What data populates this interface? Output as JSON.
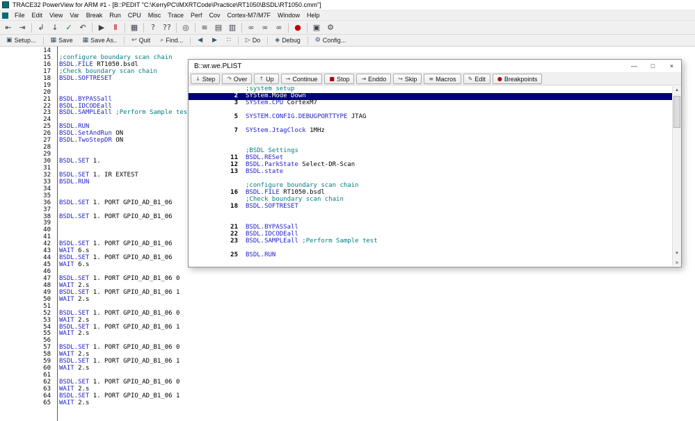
{
  "window": {
    "title": "TRACE32 PowerView for ARM #1 - [B::PEDIT \"C:\\KerryPC\\IMXRTCode\\Practice\\RT1050\\BSDL\\RT1050.cmm\"]"
  },
  "menu": {
    "items": [
      "File",
      "Edit",
      "View",
      "Var",
      "Break",
      "Run",
      "CPU",
      "Misc",
      "Trace",
      "Perf",
      "Cov",
      "Cortex-M7/M7F",
      "Window",
      "Help"
    ]
  },
  "toolbar": {
    "groups": [
      [
        {
          "name": "nav-back-icon",
          "glyph": "⇤"
        },
        {
          "name": "nav-forward-icon",
          "glyph": "⇥"
        }
      ],
      [
        {
          "name": "step-return-icon",
          "glyph": "↲"
        },
        {
          "name": "step-down-icon",
          "glyph": "↓"
        },
        {
          "name": "check-icon",
          "glyph": "✓",
          "color": "#1a7a1a"
        },
        {
          "name": "undo-icon",
          "glyph": "↶"
        }
      ],
      [
        {
          "name": "go-icon",
          "glyph": "▶"
        },
        {
          "name": "break-icon",
          "glyph": "Ⅱ",
          "color": "#aa0000"
        }
      ],
      [
        {
          "name": "dump-icon",
          "glyph": "▦"
        }
      ],
      [
        {
          "name": "help-icon",
          "glyph": "?"
        },
        {
          "name": "var-query-icon",
          "glyph": "??"
        }
      ],
      [
        {
          "name": "registers-icon",
          "glyph": "◎"
        }
      ],
      [
        {
          "name": "list-icon",
          "glyph": "≡"
        },
        {
          "name": "memory-icon",
          "glyph": "▤"
        },
        {
          "name": "peripherals-icon",
          "glyph": "▥"
        }
      ],
      [
        {
          "name": "watch-icon",
          "glyph": "∞"
        },
        {
          "name": "watch-var-icon",
          "glyph": "∞"
        },
        {
          "name": "watch-local-icon",
          "glyph": "∞"
        }
      ],
      [
        {
          "name": "breakpoint-list-icon",
          "glyph": "●",
          "color": "#c00000"
        }
      ],
      [
        {
          "name": "chip-icon",
          "glyph": "▣"
        },
        {
          "name": "tools-icon",
          "glyph": "⚙"
        }
      ]
    ]
  },
  "cmdbar": {
    "groups": [
      [
        {
          "name": "setup-button",
          "icon": "▣",
          "label": "Setup..."
        }
      ],
      [
        {
          "name": "save-button",
          "icon": "▦",
          "label": "Save"
        },
        {
          "name": "save-as-button",
          "icon": "▦",
          "label": "Save As.."
        }
      ],
      [
        {
          "name": "quit-button",
          "icon": "↩",
          "label": "Quit"
        },
        {
          "name": "find-button",
          "icon": "⌕",
          "label": "Find..."
        }
      ],
      [
        {
          "name": "scroll-left-button",
          "icon": "◀",
          "label": ""
        },
        {
          "name": "scroll-right-button",
          "icon": "▶",
          "label": ""
        },
        {
          "name": "tile-button",
          "icon": "∷",
          "label": ""
        }
      ],
      [
        {
          "name": "do-button",
          "icon": "▷",
          "label": "Do"
        }
      ],
      [
        {
          "name": "debug-button",
          "icon": "◈",
          "label": "Debug"
        }
      ],
      [
        {
          "name": "config-button",
          "icon": "⚙",
          "label": "Config..."
        }
      ]
    ]
  },
  "editor": {
    "lines": [
      {
        "n": 14
      },
      {
        "n": 15,
        "s": [
          [
            "com",
            ";configure boundary scan chain"
          ]
        ]
      },
      {
        "n": 16,
        "s": [
          [
            "cmd",
            "BSDL.FILE"
          ],
          [
            "arg",
            " RT1050.bsdl"
          ]
        ]
      },
      {
        "n": 17,
        "s": [
          [
            "com",
            ";Check boundary scan chain"
          ]
        ]
      },
      {
        "n": 18,
        "s": [
          [
            "cmd",
            "BSDL.SOFTRESET"
          ]
        ]
      },
      {
        "n": 19
      },
      {
        "n": 20
      },
      {
        "n": 21,
        "s": [
          [
            "cmd",
            "BSDL.BYPASSall"
          ]
        ]
      },
      {
        "n": 22,
        "s": [
          [
            "cmd",
            "BSDL.IDCODEall"
          ]
        ]
      },
      {
        "n": 23,
        "s": [
          [
            "cmd",
            "BSDL.SAMPLEall"
          ],
          [
            "com",
            " ;Perform Sample test"
          ]
        ]
      },
      {
        "n": 24
      },
      {
        "n": 25,
        "s": [
          [
            "cmd",
            "BSDL.RUN"
          ]
        ]
      },
      {
        "n": 26,
        "s": [
          [
            "cmd",
            "BSDL.SetAndRun"
          ],
          [
            "arg",
            " ON"
          ]
        ]
      },
      {
        "n": 27,
        "s": [
          [
            "cmd",
            "BSDL.TwoStepDR"
          ],
          [
            "arg",
            " ON"
          ]
        ]
      },
      {
        "n": 28
      },
      {
        "n": 29
      },
      {
        "n": 30,
        "s": [
          [
            "cmd",
            "BSDL.SET"
          ],
          [
            "arg",
            " 1."
          ]
        ]
      },
      {
        "n": 31
      },
      {
        "n": 32,
        "s": [
          [
            "cmd",
            "BSDL.SET"
          ],
          [
            "arg",
            " 1. IR EXTEST"
          ]
        ]
      },
      {
        "n": 33,
        "s": [
          [
            "cmd",
            "BSDL.RUN"
          ]
        ]
      },
      {
        "n": 34
      },
      {
        "n": 35
      },
      {
        "n": 36,
        "s": [
          [
            "cmd",
            "BSDL.SET"
          ],
          [
            "arg",
            " 1. PORT GPIO_AD_B1_06"
          ]
        ]
      },
      {
        "n": 37
      },
      {
        "n": 38,
        "s": [
          [
            "cmd",
            "BSDL.SET"
          ],
          [
            "arg",
            " 1. PORT GPIO_AD_B1_06"
          ]
        ]
      },
      {
        "n": 39
      },
      {
        "n": 40
      },
      {
        "n": 41
      },
      {
        "n": 42,
        "s": [
          [
            "cmd",
            "BSDL.SET"
          ],
          [
            "arg",
            " 1. PORT GPIO_AD_B1_06"
          ]
        ]
      },
      {
        "n": 43,
        "s": [
          [
            "cmd",
            "WAIT"
          ],
          [
            "arg",
            " 6.s"
          ]
        ]
      },
      {
        "n": 44,
        "s": [
          [
            "cmd",
            "BSDL.SET"
          ],
          [
            "arg",
            " 1. PORT GPIO_AD_B1_06"
          ]
        ]
      },
      {
        "n": 45,
        "s": [
          [
            "cmd",
            "WAIT"
          ],
          [
            "arg",
            " 6.s"
          ]
        ]
      },
      {
        "n": 46
      },
      {
        "n": 47,
        "s": [
          [
            "cmd",
            "BSDL.SET"
          ],
          [
            "arg",
            " 1. PORT GPIO_AD_B1_06 0"
          ]
        ]
      },
      {
        "n": 48,
        "s": [
          [
            "cmd",
            "WAIT"
          ],
          [
            "arg",
            " 2.s"
          ]
        ]
      },
      {
        "n": 49,
        "s": [
          [
            "cmd",
            "BSDL.SET"
          ],
          [
            "arg",
            " 1. PORT GPIO_AD_B1_06 1"
          ]
        ]
      },
      {
        "n": 50,
        "s": [
          [
            "cmd",
            "WAIT"
          ],
          [
            "arg",
            " 2.s"
          ]
        ]
      },
      {
        "n": 51
      },
      {
        "n": 52,
        "s": [
          [
            "cmd",
            "BSDL.SET"
          ],
          [
            "arg",
            " 1. PORT GPIO_AD_B1_06 0"
          ]
        ]
      },
      {
        "n": 53,
        "s": [
          [
            "cmd",
            "WAIT"
          ],
          [
            "arg",
            " 2.s"
          ]
        ]
      },
      {
        "n": 54,
        "s": [
          [
            "cmd",
            "BSDL.SET"
          ],
          [
            "arg",
            " 1. PORT GPIO_AD_B1_06 1"
          ]
        ]
      },
      {
        "n": 55,
        "s": [
          [
            "cmd",
            "WAIT"
          ],
          [
            "arg",
            " 2.s"
          ]
        ]
      },
      {
        "n": 56
      },
      {
        "n": 57,
        "s": [
          [
            "cmd",
            "BSDL.SET"
          ],
          [
            "arg",
            " 1. PORT GPIO_AD_B1_06 0"
          ]
        ]
      },
      {
        "n": 58,
        "s": [
          [
            "cmd",
            "WAIT"
          ],
          [
            "arg",
            " 2.s"
          ]
        ]
      },
      {
        "n": 59,
        "s": [
          [
            "cmd",
            "BSDL.SET"
          ],
          [
            "arg",
            " 1. PORT GPIO_AD_B1_06 1"
          ]
        ]
      },
      {
        "n": 60,
        "s": [
          [
            "cmd",
            "WAIT"
          ],
          [
            "arg",
            " 2.s"
          ]
        ]
      },
      {
        "n": 61
      },
      {
        "n": 62,
        "s": [
          [
            "cmd",
            "BSDL.SET"
          ],
          [
            "arg",
            " 1. PORT GPIO_AD_B1_06 0"
          ]
        ]
      },
      {
        "n": 63,
        "s": [
          [
            "cmd",
            "WAIT"
          ],
          [
            "arg",
            " 2.s"
          ]
        ]
      },
      {
        "n": 64,
        "s": [
          [
            "cmd",
            "BSDL.SET"
          ],
          [
            "arg",
            " 1. PORT GPIO_AD_B1_06 1"
          ]
        ]
      },
      {
        "n": 65,
        "s": [
          [
            "cmd",
            "WAIT"
          ],
          [
            "arg",
            " 2.s"
          ]
        ]
      }
    ]
  },
  "plist": {
    "title": "B::wr.we.PLIST",
    "controls": {
      "minimize": "—",
      "maximize": "□",
      "close": "×"
    },
    "buttons": [
      {
        "name": "step-button",
        "icon": "↓",
        "label": "Step"
      },
      {
        "name": "over-button",
        "icon": "↷",
        "label": "Over"
      },
      {
        "name": "up-button",
        "icon": "↑",
        "label": "Up"
      },
      {
        "name": "continue-button",
        "icon": "→",
        "label": "Continue"
      },
      {
        "name": "stop-button",
        "icon": "■",
        "icon_color": "#b00000",
        "label": "Stop"
      },
      {
        "name": "enddo-button",
        "icon": "⇥",
        "label": "Enddo"
      },
      {
        "name": "skip-button",
        "icon": "↪",
        "label": "Skip"
      },
      {
        "name": "macros-button",
        "icon": "≡",
        "label": "Macros"
      },
      {
        "name": "edit-button",
        "icon": "✎",
        "label": "Edit"
      },
      {
        "name": "breakpoints-button",
        "icon": "●",
        "icon_color": "#b00000",
        "label": "Breakpoints"
      }
    ],
    "rows": [
      {
        "s": [
          [
            "com",
            ";system setup"
          ]
        ]
      },
      {
        "n": 2,
        "sel": true,
        "s": [
          [
            "cmd",
            "SYStem.Mode"
          ],
          [
            "arg",
            " Down"
          ]
        ]
      },
      {
        "n": 3,
        "s": [
          [
            "cmd",
            "SYStem.CPU"
          ],
          [
            "arg",
            " CortexM7"
          ]
        ]
      },
      {},
      {
        "n": 5,
        "s": [
          [
            "cmd",
            "SYSTEM.CONFIG.DEBUGPORTTYPE"
          ],
          [
            "arg",
            " JTAG"
          ]
        ]
      },
      {},
      {
        "n": 7,
        "s": [
          [
            "cmd",
            "SYStem.JtagClock"
          ],
          [
            "arg",
            " 1MHz"
          ]
        ]
      },
      {},
      {},
      {
        "s": [
          [
            "com",
            ";BSDL Settings"
          ]
        ]
      },
      {
        "n": 11,
        "s": [
          [
            "cmd",
            "BSDL.RESet"
          ]
        ]
      },
      {
        "n": 12,
        "s": [
          [
            "cmd",
            "BSDL.ParkState"
          ],
          [
            "arg",
            " Select-DR-Scan"
          ]
        ]
      },
      {
        "n": 13,
        "s": [
          [
            "cmd",
            "BSDL.state"
          ]
        ]
      },
      {},
      {
        "s": [
          [
            "com",
            ";configure boundary scan chain"
          ]
        ]
      },
      {
        "n": 16,
        "s": [
          [
            "cmd",
            "BSDL.FILE"
          ],
          [
            "arg",
            " RT1050.bsdl"
          ]
        ]
      },
      {
        "s": [
          [
            "com",
            ";Check boundary scan chain"
          ]
        ]
      },
      {
        "n": 18,
        "s": [
          [
            "cmd",
            "BSDL.SOFTRESET"
          ]
        ]
      },
      {},
      {},
      {
        "n": 21,
        "s": [
          [
            "cmd",
            "BSDL.BYPASSall"
          ]
        ]
      },
      {
        "n": 22,
        "s": [
          [
            "cmd",
            "BSDL.IDCODEall"
          ]
        ]
      },
      {
        "n": 23,
        "s": [
          [
            "cmd",
            "BSDL.SAMPLEall"
          ],
          [
            "com",
            " ;Perform Sample test"
          ]
        ]
      },
      {},
      {
        "n": 25,
        "s": [
          [
            "cmd",
            "BSDL.RUN"
          ]
        ]
      }
    ],
    "scrollbar": {
      "up": "▲",
      "down": "▼",
      "more": "»"
    }
  },
  "colors": {
    "command": "#2222cc",
    "comment": "#007f7f",
    "argument": "#000000",
    "selection_bg": "#000080",
    "selection_fg": "#ffffff",
    "app_icon": "#0b6b74"
  }
}
